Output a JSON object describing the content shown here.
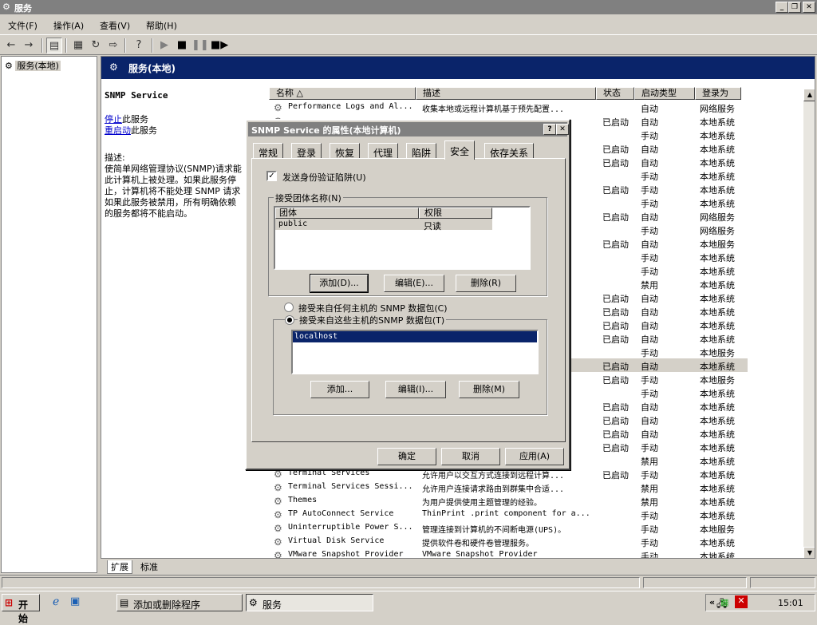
{
  "window": {
    "title": "服务"
  },
  "menu": [
    "文件(F)",
    "操作(A)",
    "查看(V)",
    "帮助(H)"
  ],
  "tree": {
    "item": "服务(本地)"
  },
  "panel": {
    "header": "服务(本地)",
    "service_name": "SNMP Service",
    "stop_link": "停止",
    "stop_rest": "此服务",
    "restart_link": "重启动",
    "restart_rest": "此服务",
    "desc_label": "描述:",
    "desc_lines": [
      "使简单网络管理协议(SNMP)请求能",
      "此计算机上被处理。如果此服务停",
      "止，计算机将不能处理 SNMP 请求",
      "如果此服务被禁用，所有明确依赖",
      "的服务都将不能启动。"
    ]
  },
  "columns": [
    "名称 △",
    "描述",
    "状态",
    "启动类型",
    "登录为"
  ],
  "rows": [
    {
      "name": "Performance Logs and Al...",
      "desc": "收集本地或远程计算机基于预先配置...",
      "status": "",
      "startup": "自动",
      "logon": "网络服务"
    },
    {
      "name": "",
      "desc": "",
      "status": "已启动",
      "startup": "自动",
      "logon": "本地系统"
    },
    {
      "name": "",
      "desc": "",
      "status": "",
      "startup": "手动",
      "logon": "本地系统"
    },
    {
      "name": "",
      "desc": "",
      "status": "已启动",
      "startup": "自动",
      "logon": "本地系统"
    },
    {
      "name": "",
      "desc": "",
      "status": "已启动",
      "startup": "自动",
      "logon": "本地系统"
    },
    {
      "name": "",
      "desc": "",
      "status": "",
      "startup": "手动",
      "logon": "本地系统"
    },
    {
      "name": "",
      "desc": "",
      "status": "已启动",
      "startup": "手动",
      "logon": "本地系统"
    },
    {
      "name": "",
      "desc": "",
      "status": "",
      "startup": "手动",
      "logon": "本地系统"
    },
    {
      "name": "",
      "desc": "",
      "status": "已启动",
      "startup": "自动",
      "logon": "网络服务"
    },
    {
      "name": "",
      "desc": "",
      "status": "",
      "startup": "手动",
      "logon": "网络服务"
    },
    {
      "name": "",
      "desc": "",
      "status": "已启动",
      "startup": "自动",
      "logon": "本地服务"
    },
    {
      "name": "",
      "desc": "",
      "status": "",
      "startup": "手动",
      "logon": "本地系统"
    },
    {
      "name": "",
      "desc": "",
      "status": "",
      "startup": "手动",
      "logon": "本地系统"
    },
    {
      "name": "",
      "desc": "",
      "status": "",
      "startup": "禁用",
      "logon": "本地系统"
    },
    {
      "name": "",
      "desc": "",
      "status": "已启动",
      "startup": "自动",
      "logon": "本地系统"
    },
    {
      "name": "",
      "desc": "",
      "status": "已启动",
      "startup": "自动",
      "logon": "本地系统"
    },
    {
      "name": "",
      "desc": "",
      "status": "已启动",
      "startup": "自动",
      "logon": "本地系统"
    },
    {
      "name": "",
      "desc": "",
      "status": "已启动",
      "startup": "自动",
      "logon": "本地系统"
    },
    {
      "name": "",
      "desc": "",
      "status": "",
      "startup": "手动",
      "logon": "本地服务"
    },
    {
      "name": "",
      "desc": "",
      "status": "已启动",
      "startup": "自动",
      "logon": "本地系统",
      "selected": true
    },
    {
      "name": "",
      "desc": "",
      "status": "已启动",
      "startup": "手动",
      "logon": "本地服务"
    },
    {
      "name": "",
      "desc": "",
      "status": "",
      "startup": "手动",
      "logon": "本地系统"
    },
    {
      "name": "",
      "desc": "",
      "status": "已启动",
      "startup": "自动",
      "logon": "本地系统"
    },
    {
      "name": "",
      "desc": "",
      "status": "已启动",
      "startup": "自动",
      "logon": "本地系统"
    },
    {
      "name": "",
      "desc": "",
      "status": "已启动",
      "startup": "自动",
      "logon": "本地系统"
    },
    {
      "name": "",
      "desc": "",
      "status": "已启动",
      "startup": "手动",
      "logon": "本地系统"
    },
    {
      "name": "",
      "desc": "",
      "status": "",
      "startup": "禁用",
      "logon": "本地系统"
    },
    {
      "name": "Terminal Services",
      "desc": "允许用户以交互方式连接到远程计算...",
      "status": "已启动",
      "startup": "手动",
      "logon": "本地系统"
    },
    {
      "name": "Terminal Services Sessi...",
      "desc": "允许用户连接请求路由到群集中合适...",
      "status": "",
      "startup": "禁用",
      "logon": "本地系统"
    },
    {
      "name": "Themes",
      "desc": "为用户提供使用主题管理的经验。",
      "status": "",
      "startup": "禁用",
      "logon": "本地系统"
    },
    {
      "name": "TP AutoConnect Service",
      "desc": "ThinPrint .print component for a...",
      "status": "",
      "startup": "手动",
      "logon": "本地系统"
    },
    {
      "name": "Uninterruptible Power S...",
      "desc": "管理连接到计算机的不间断电源(UPS)。",
      "status": "",
      "startup": "手动",
      "logon": "本地服务"
    },
    {
      "name": "Virtual Disk Service",
      "desc": "提供软件卷和硬件卷管理服务。",
      "status": "",
      "startup": "手动",
      "logon": "本地系统"
    },
    {
      "name": "VMware Snapshot Provider",
      "desc": "VMware Snapshot Provider",
      "status": "",
      "startup": "手动",
      "logon": "本地系统"
    }
  ],
  "bottom_tabs": [
    "扩展",
    "标准"
  ],
  "taskbar": {
    "start": "开始",
    "tasks": [
      "添加或删除程序",
      "服务"
    ],
    "clock": "15:01"
  },
  "dialog": {
    "title": "SNMP Service 的属性(本地计算机)",
    "tabs": [
      "常规",
      "登录",
      "恢复",
      "代理",
      "陷阱",
      "安全",
      "依存关系"
    ],
    "send_auth_trap": "发送身份验证陷阱(U)",
    "communities_group": "接受团体名称(N)",
    "col_community": "团体",
    "col_rights": "权限",
    "community": "public",
    "rights": "只读",
    "btn_add1": "添加(D)...",
    "btn_edit1": "编辑(E)...",
    "btn_remove1": "删除(R)",
    "radio_any": "接受来自任何主机的 SNMP 数据包(C)",
    "radio_these": "接受来自这些主机的SNMP 数据包(T)",
    "host": "localhost",
    "btn_add2": "添加...",
    "btn_edit2": "编辑(I)...",
    "btn_remove2": "删除(M)",
    "ok": "确定",
    "cancel": "取消",
    "apply": "应用(A)"
  }
}
